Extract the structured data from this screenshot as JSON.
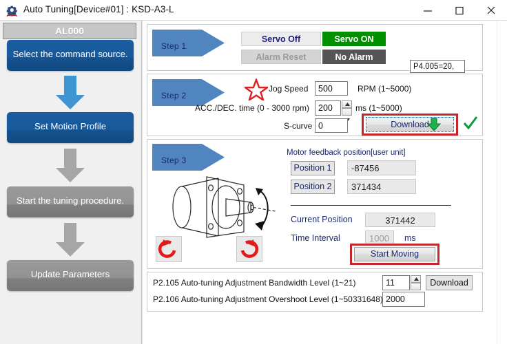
{
  "window": {
    "title": "Auto Tuning[Device#01]  : KSD-A3-L",
    "icon": "gear-icon",
    "minimize": "minimize-icon",
    "maximize": "maximize-icon",
    "close": "close-icon"
  },
  "sidebar": {
    "header": "AL000",
    "items": [
      {
        "label": "Select the command source.",
        "state": "active"
      },
      {
        "label": "Set Motion Profile",
        "state": "active"
      },
      {
        "label": "Start the tuning procedure.",
        "state": "disabled"
      },
      {
        "label": "Update Parameters",
        "state": "disabled"
      }
    ],
    "colors": {
      "active": "#14528e",
      "disabled": "#808080",
      "arrow_active": "#3f95d2",
      "arrow_disabled": "#a6a6a6"
    }
  },
  "step1": {
    "title": "Step 1",
    "servo_off": "Servo Off",
    "servo_on": "Servo ON",
    "alarm_reset": "Alarm Reset",
    "no_alarm": "No Alarm",
    "tooltip": "P4.005=20,",
    "colors": {
      "on": "#009000",
      "dark": "#555555",
      "chevron": "#5085bf"
    }
  },
  "step2": {
    "title": "Step 2",
    "jog_speed_label": "Jog Speed",
    "jog_speed_value": "500",
    "jog_speed_unit": "RPM (1~5000)",
    "accdec_label": "ACC./DEC. time (0 - 3000 rpm)",
    "accdec_value": "200",
    "accdec_unit": "ms (1~5000)",
    "scurve_label": "S-curve",
    "scurve_value": "0",
    "download_label": "Download",
    "star_icon": "star-icon",
    "check_icon": "check-icon",
    "highlight_color": "#c1272d"
  },
  "step3": {
    "title": "Step 3",
    "feedback_title": "Motor feedback position[user unit]",
    "position1_label": "Position 1",
    "position1_value": "-87456",
    "position2_label": "Position 2",
    "position2_value": "371434",
    "current_position_label": "Current Position",
    "current_position_value": "371442",
    "time_interval_label": "Time Interval",
    "time_interval_value": "1000",
    "time_interval_unit": "ms",
    "start_moving_label": "Start Moving",
    "rotate_ccw_icon": "rotate-counterclockwise-icon",
    "rotate_cw_icon": "rotate-clockwise-icon",
    "motor_icon": "motor-diagram-icon"
  },
  "params": {
    "rows": [
      {
        "label": "P2.105 Auto-tuning Adjustment Bandwidth Level (1~21)",
        "value": "11",
        "spinner": true
      },
      {
        "label": "P2.106 Auto-tuning Adjustment Overshoot Level (1~50331648)",
        "value": "2000",
        "spinner": false
      }
    ],
    "download_label": "Download"
  }
}
